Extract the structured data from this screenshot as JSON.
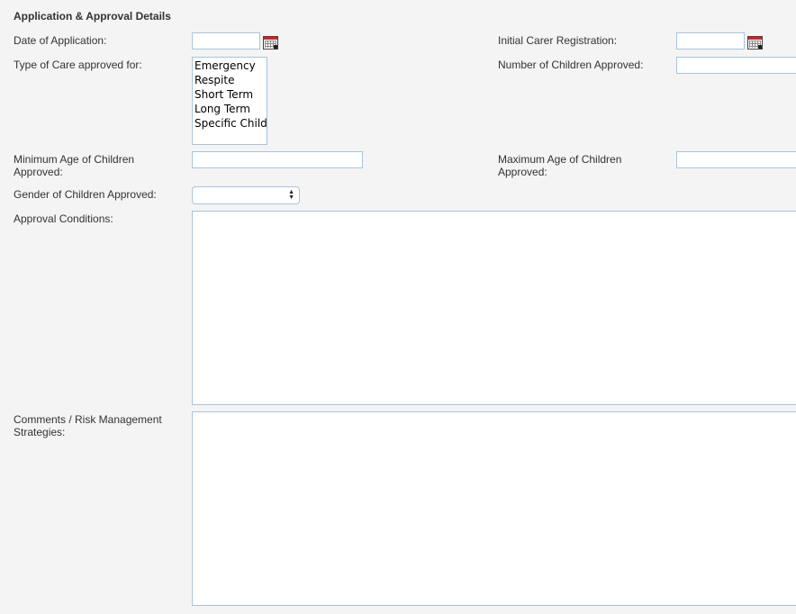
{
  "section": {
    "title": "Application & Approval Details"
  },
  "fields": {
    "date_of_application": {
      "label": "Date of Application:",
      "value": ""
    },
    "initial_carer_registration": {
      "label": "Initial Carer Registration:",
      "value": ""
    },
    "type_of_care": {
      "label": "Type of Care approved for:",
      "options": [
        "Emergency",
        "Respite",
        "Short Term",
        "Long Term",
        "Specific Child"
      ]
    },
    "number_of_children": {
      "label": "Number of Children Approved:",
      "value": ""
    },
    "min_age": {
      "label_line1": "Minimum Age of Children",
      "label_line2": "Approved:",
      "value": ""
    },
    "max_age": {
      "label_line1": "Maximum Age of Children",
      "label_line2": "Approved:",
      "value": ""
    },
    "gender": {
      "label": "Gender of Children Approved:",
      "selected": ""
    },
    "approval_conditions": {
      "label": "Approval Conditions:",
      "value": ""
    },
    "comments": {
      "label_line1": "Comments / Risk Management",
      "label_line2": "Strategies:",
      "value": ""
    }
  },
  "icons": {
    "calendar": "calendar-icon",
    "select_arrows": "updown-arrows-icon"
  }
}
